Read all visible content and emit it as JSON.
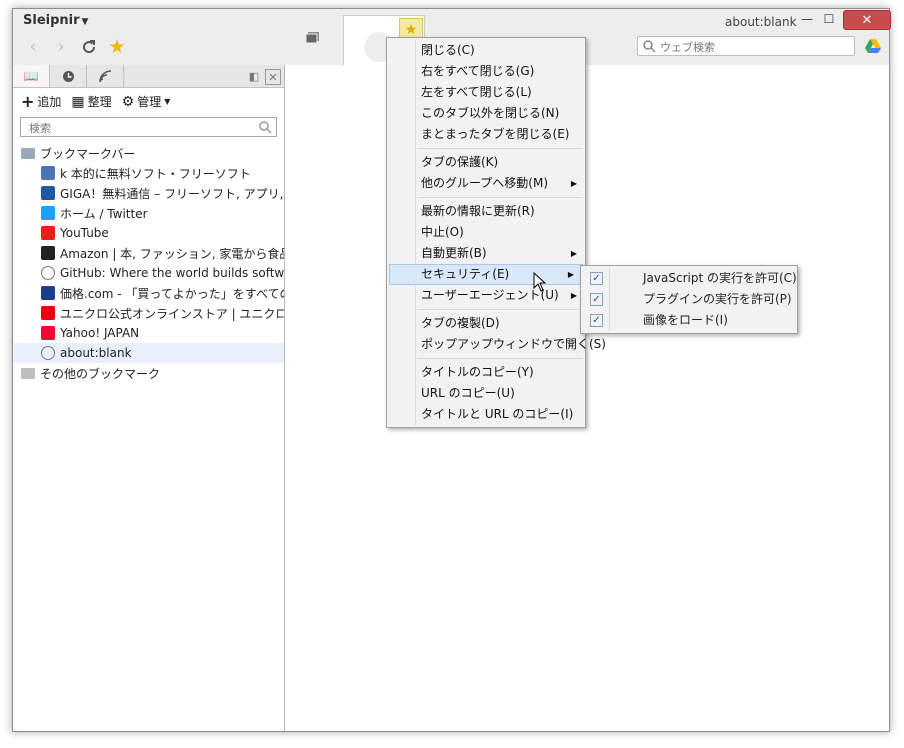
{
  "app": {
    "title": "Sleipnir",
    "url_label": "about:blank"
  },
  "search": {
    "placeholder": "ウェブ検索"
  },
  "sidebar": {
    "toolbar": {
      "add": "追加",
      "organize": "整理",
      "manage": "管理"
    },
    "search_placeholder": "検索",
    "bookmarks": [
      {
        "label": "ブックマークバー",
        "icon": "bookmark-bar-folder-icon",
        "level": 0,
        "color": "#9ba9bb"
      },
      {
        "label": "k 本的に無料ソフト・フリーソフト",
        "icon": "k-site-icon",
        "level": 1,
        "color": "#4a73b8"
      },
      {
        "label": "GIGA！無料通信 – フリーソフト, アプリ, 無料の",
        "icon": "giga-icon",
        "level": 1,
        "color": "#1f5aa0"
      },
      {
        "label": "ホーム / Twitter",
        "icon": "twitter-icon",
        "level": 1,
        "color": "#1da1f2"
      },
      {
        "label": "YouTube",
        "icon": "youtube-icon",
        "level": 1,
        "color": "#e62117"
      },
      {
        "label": "Amazon | 本, ファッション, 家電から食品まで |",
        "icon": "amazon-icon",
        "level": 1,
        "color": "#222222"
      },
      {
        "label": "GitHub: Where the world builds software ·",
        "icon": "globe-icon",
        "level": 1,
        "color": "#777777"
      },
      {
        "label": "価格.com - 「買ってよかった」をすべてのひとに。",
        "icon": "kakaku-icon",
        "level": 1,
        "color": "#1a3e8c"
      },
      {
        "label": "ユニクロ公式オンラインストア | ユニクロ",
        "icon": "uniqlo-icon",
        "level": 1,
        "color": "#e60012"
      },
      {
        "label": "Yahoo! JAPAN",
        "icon": "yahoo-icon",
        "level": 1,
        "color": "#ff0033"
      },
      {
        "label": "about:blank",
        "icon": "globe-icon",
        "level": 1,
        "color": "#777777",
        "selected": true
      },
      {
        "label": "その他のブックマーク",
        "icon": "folder-icon",
        "level": 0,
        "color": "#bdbdbd"
      }
    ]
  },
  "context_menu": {
    "groups": [
      [
        "閉じる(C)",
        "右をすべて閉じる(G)",
        "左をすべて閉じる(L)",
        "このタブ以外を閉じる(N)",
        "まとまったタブを閉じる(E)"
      ],
      [
        "タブの保護(K)",
        "他のグループへ移動(M)"
      ],
      [
        "最新の情報に更新(R)",
        "中止(O)",
        "自動更新(B)",
        "セキュリティ(E)",
        "ユーザーエージェント(U)"
      ],
      [
        "タブの複製(D)",
        "ポップアップウィンドウで開く(S)"
      ],
      [
        "タイトルのコピー(Y)",
        "URL のコピー(U)",
        "タイトルと URL のコピー(I)"
      ]
    ],
    "submenu_items": [
      "他のグループへ移動(M)",
      "自動更新(B)",
      "セキュリティ(E)",
      "ユーザーエージェント(U)"
    ],
    "highlighted": "セキュリティ(E)"
  },
  "security_submenu": [
    {
      "label": "JavaScript の実行を許可(C)",
      "checked": true
    },
    {
      "label": "プラグインの実行を許可(P)",
      "checked": true
    },
    {
      "label": "画像をロード(I)",
      "checked": true
    }
  ]
}
